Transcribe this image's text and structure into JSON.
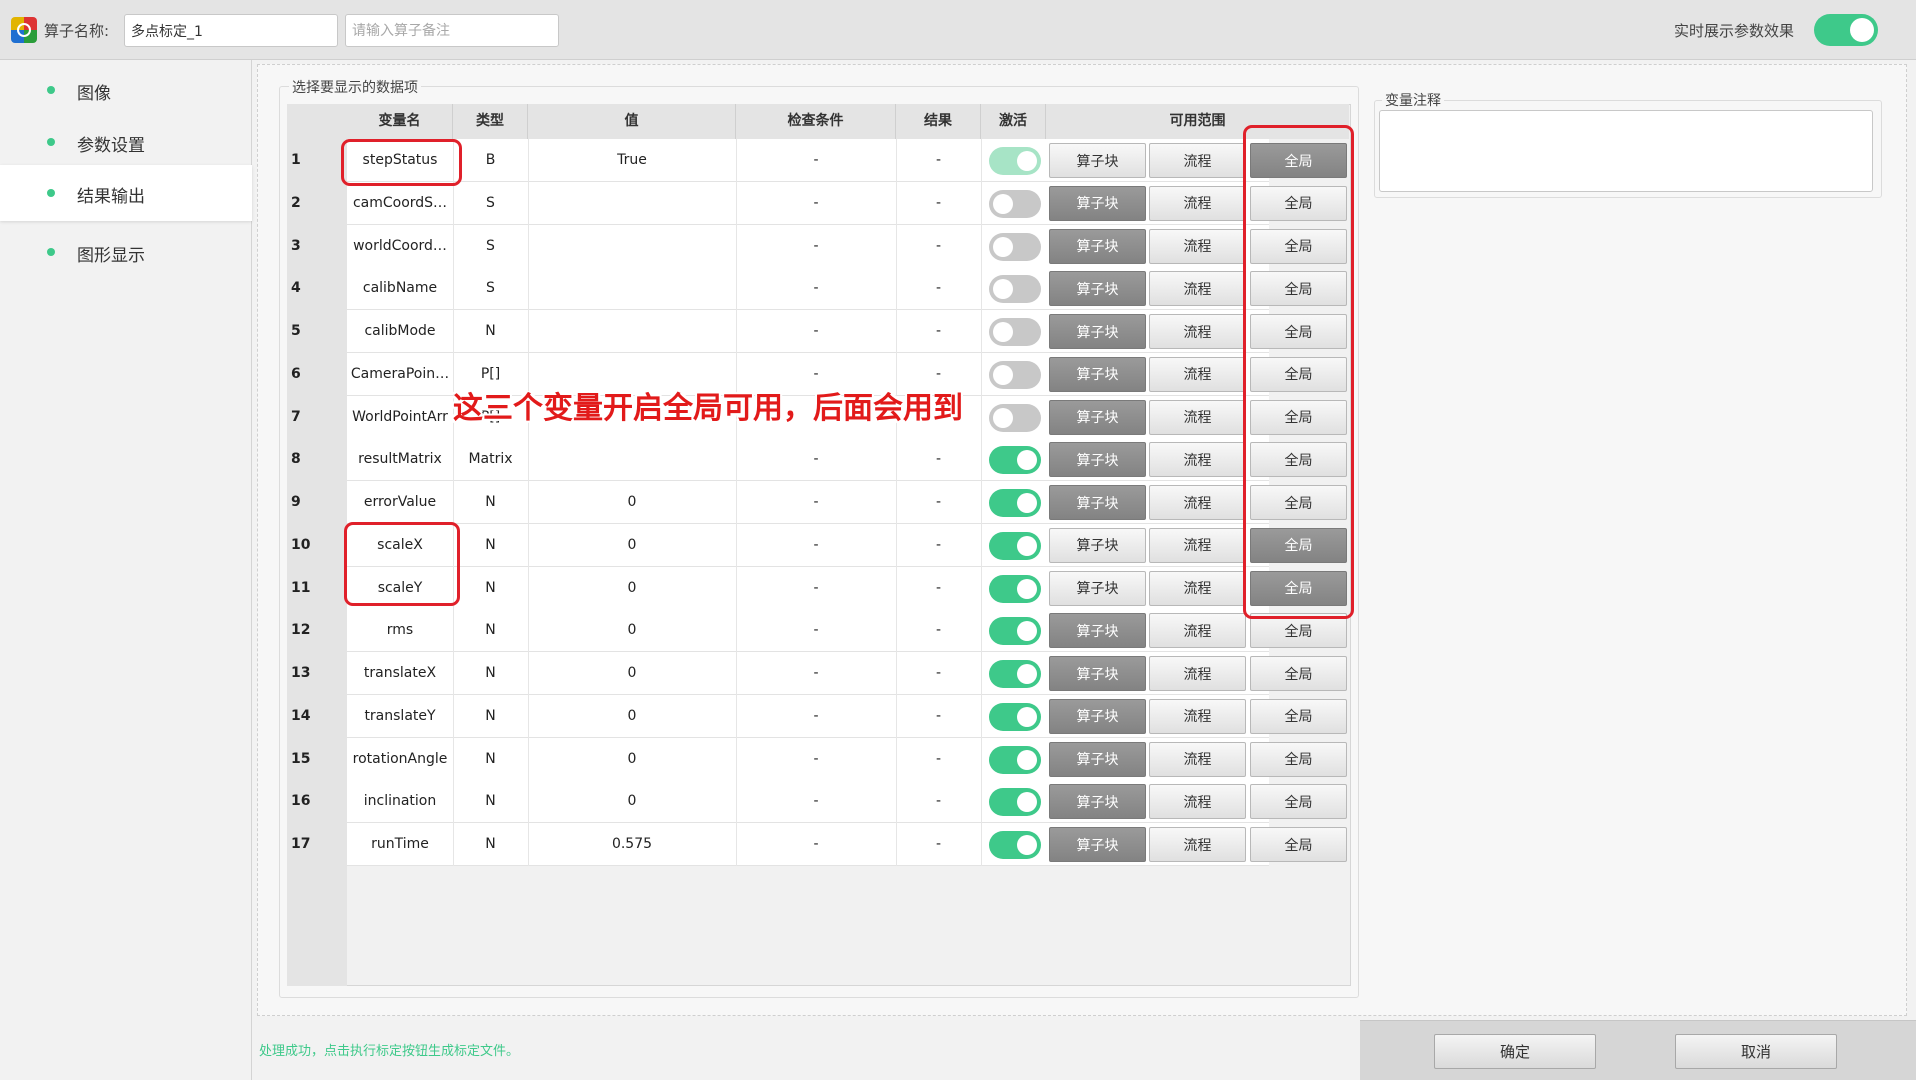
{
  "header": {
    "name_label": "算子名称:",
    "name_value": "多点标定_1",
    "note_placeholder": "请输入算子备注",
    "realtime_label": "实时展示参数效果",
    "realtime_on": true
  },
  "sidebar": {
    "items": [
      {
        "label": "图像",
        "active": false
      },
      {
        "label": "参数设置",
        "active": false
      },
      {
        "label": "结果输出",
        "active": true
      },
      {
        "label": "图形显示",
        "active": false
      }
    ]
  },
  "panel": {
    "title": "选择要显示的数据项"
  },
  "table": {
    "headers": {
      "name": "变量名",
      "type": "类型",
      "value": "值",
      "condition": "检查条件",
      "result": "结果",
      "active": "激活",
      "scope": "可用范围"
    },
    "scope_labels": [
      "算子块",
      "流程",
      "全局"
    ],
    "rows": [
      {
        "idx": "1",
        "name": "stepStatus",
        "type": "B",
        "value": "True",
        "cond": "-",
        "res": "-",
        "active": "dim",
        "scope": [
          false,
          false,
          true
        ]
      },
      {
        "idx": "2",
        "name": "camCoordS…",
        "type": "S",
        "value": "",
        "cond": "-",
        "res": "-",
        "active": "off",
        "scope": [
          true,
          false,
          false
        ]
      },
      {
        "idx": "3",
        "name": "worldCoord…",
        "type": "S",
        "value": "",
        "cond": "-",
        "res": "-",
        "active": "off",
        "scope": [
          true,
          false,
          false
        ]
      },
      {
        "idx": "4",
        "name": "calibName",
        "type": "S",
        "value": "",
        "cond": "-",
        "res": "-",
        "active": "off",
        "scope": [
          true,
          false,
          false
        ]
      },
      {
        "idx": "5",
        "name": "calibMode",
        "type": "N",
        "value": "",
        "cond": "-",
        "res": "-",
        "active": "off",
        "scope": [
          true,
          false,
          false
        ]
      },
      {
        "idx": "6",
        "name": "CameraPoin…",
        "type": "P[]",
        "value": "",
        "cond": "-",
        "res": "-",
        "active": "off",
        "scope": [
          true,
          false,
          false
        ]
      },
      {
        "idx": "7",
        "name": "WorldPointArr",
        "type": "P[]",
        "value": "",
        "cond": "-",
        "res": "-",
        "active": "off",
        "scope": [
          true,
          false,
          false
        ]
      },
      {
        "idx": "8",
        "name": "resultMatrix",
        "type": "Matrix",
        "value": "",
        "cond": "-",
        "res": "-",
        "active": "on",
        "scope": [
          true,
          false,
          false
        ]
      },
      {
        "idx": "9",
        "name": "errorValue",
        "type": "N",
        "value": "0",
        "cond": "-",
        "res": "-",
        "active": "on",
        "scope": [
          true,
          false,
          false
        ]
      },
      {
        "idx": "10",
        "name": "scaleX",
        "type": "N",
        "value": "0",
        "cond": "-",
        "res": "-",
        "active": "on",
        "scope": [
          false,
          false,
          true
        ]
      },
      {
        "idx": "11",
        "name": "scaleY",
        "type": "N",
        "value": "0",
        "cond": "-",
        "res": "-",
        "active": "on",
        "scope": [
          false,
          false,
          true
        ]
      },
      {
        "idx": "12",
        "name": "rms",
        "type": "N",
        "value": "0",
        "cond": "-",
        "res": "-",
        "active": "on",
        "scope": [
          true,
          false,
          false
        ]
      },
      {
        "idx": "13",
        "name": "translateX",
        "type": "N",
        "value": "0",
        "cond": "-",
        "res": "-",
        "active": "on",
        "scope": [
          true,
          false,
          false
        ]
      },
      {
        "idx": "14",
        "name": "translateY",
        "type": "N",
        "value": "0",
        "cond": "-",
        "res": "-",
        "active": "on",
        "scope": [
          true,
          false,
          false
        ]
      },
      {
        "idx": "15",
        "name": "rotationAngle",
        "type": "N",
        "value": "0",
        "cond": "-",
        "res": "-",
        "active": "on",
        "scope": [
          true,
          false,
          false
        ]
      },
      {
        "idx": "16",
        "name": "inclination",
        "type": "N",
        "value": "0",
        "cond": "-",
        "res": "-",
        "active": "on",
        "scope": [
          true,
          false,
          false
        ]
      },
      {
        "idx": "17",
        "name": "runTime",
        "type": "N",
        "value": "0.575",
        "cond": "-",
        "res": "-",
        "active": "on",
        "scope": [
          true,
          false,
          false
        ]
      }
    ]
  },
  "annotation": {
    "text": "这三个变量开启全局可用，后面会用到"
  },
  "note_panel": {
    "title": "变量注释"
  },
  "status": {
    "text": "处理成功，点击执行标定按钮生成标定文件。"
  },
  "footer": {
    "ok_label": "确定",
    "cancel_label": "取消"
  },
  "colors": {
    "accent": "#3ec98a",
    "highlight": "#e0202a",
    "selected_button": "#8c8c8c"
  }
}
